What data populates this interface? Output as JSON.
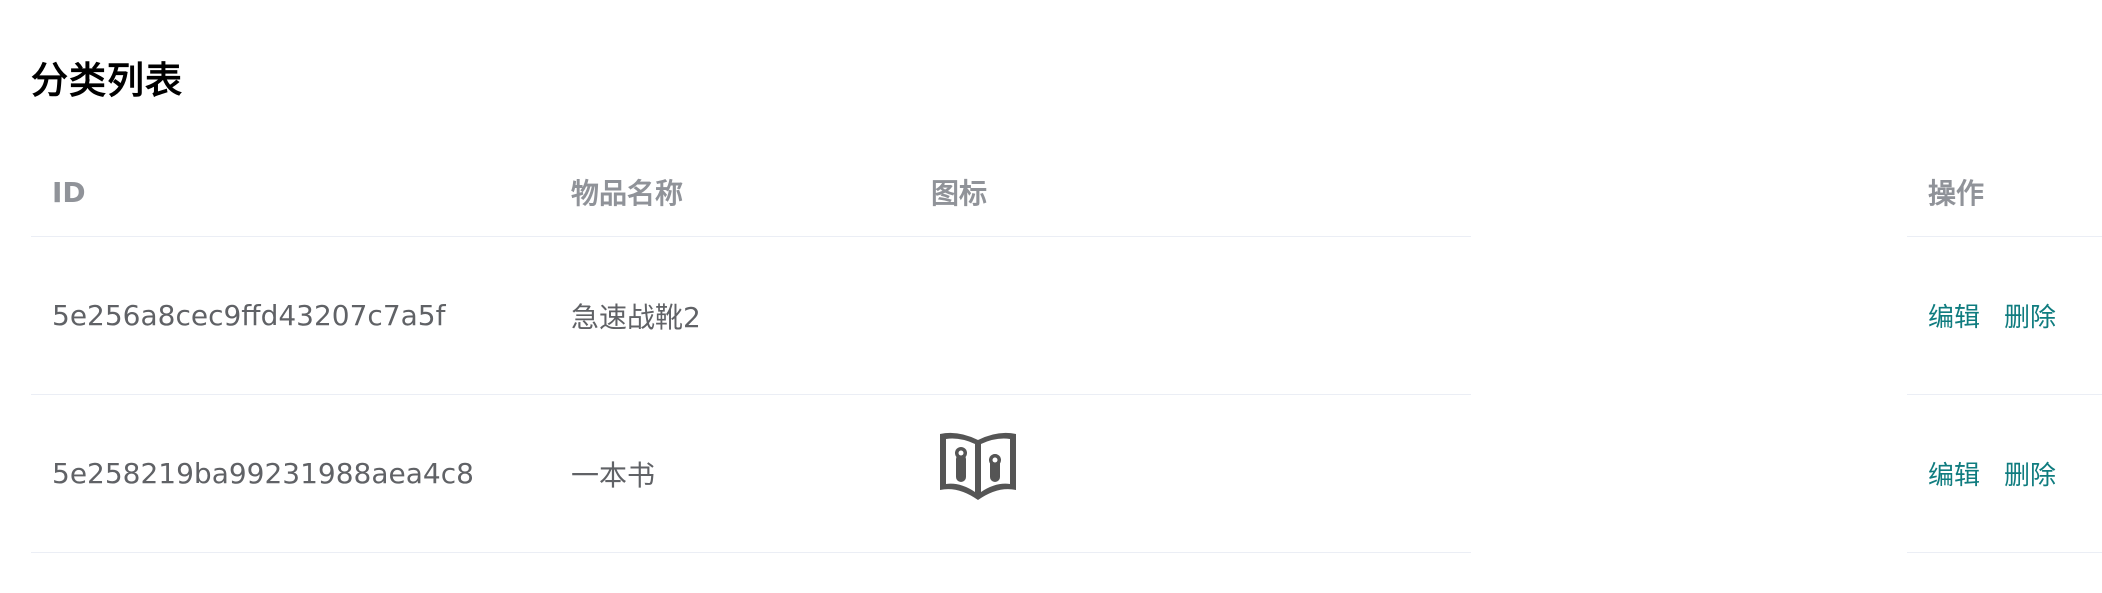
{
  "title": "分类列表",
  "table": {
    "headers": {
      "id": "ID",
      "name": "物品名称",
      "icon": "图标",
      "actions": "操作"
    },
    "rows": [
      {
        "id": "5e256a8cec9ffd43207c7a5f",
        "name": "急速战靴2",
        "icon": "",
        "edit_label": "编辑",
        "delete_label": "删除"
      },
      {
        "id": "5e258219ba99231988aea4c8",
        "name": "一本书",
        "icon": "book-icon",
        "edit_label": "编辑",
        "delete_label": "删除"
      }
    ]
  },
  "colors": {
    "link": "#0f7c7f",
    "header_text": "#909399",
    "body_text": "#606266",
    "border": "#ebeef5",
    "icon": "#555555"
  }
}
